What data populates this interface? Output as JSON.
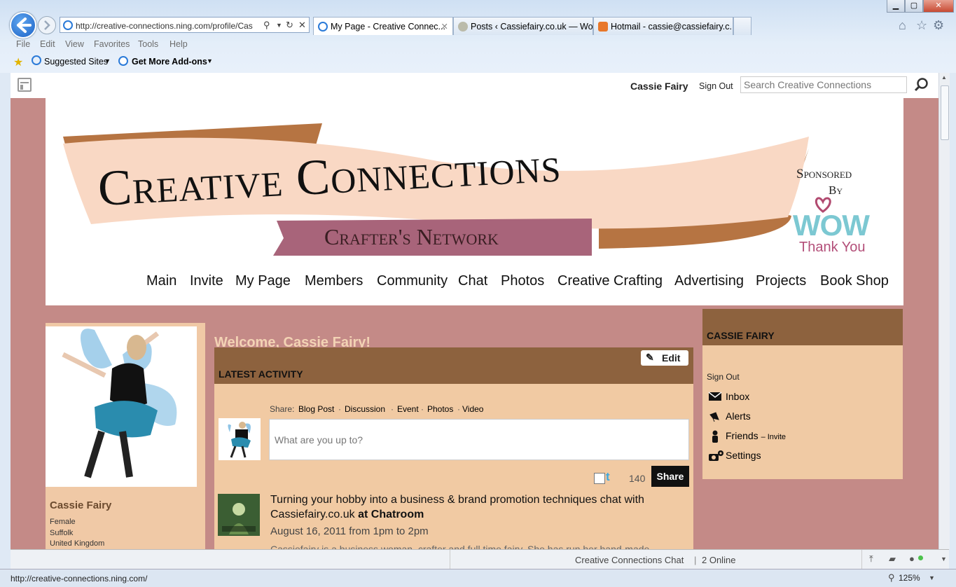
{
  "browser": {
    "url": "http://creative-connections.ning.com/profile/Cas",
    "tabs": [
      {
        "title": "My Page - Creative Connec..."
      },
      {
        "title": "Posts ‹ Cassiefairy.co.uk — Wo..."
      },
      {
        "title": "Hotmail - cassie@cassiefairy.c..."
      }
    ],
    "menu": [
      "File",
      "Edit",
      "View",
      "Favorites",
      "Tools",
      "Help"
    ],
    "favorites": {
      "suggested": "Suggested Sites",
      "addons": "Get More Add-ons"
    },
    "status_url": "http://creative-connections.ning.com/",
    "zoom": "125%"
  },
  "site": {
    "user_name": "Cassie Fairy",
    "sign_out": "Sign Out",
    "search_placeholder": "Search Creative Connections",
    "banner": {
      "title": "Creative Connections",
      "subtitle": "Crafter's Network",
      "sponsored": "Sponsored",
      "by": "By",
      "sponsor_logo": "WOW",
      "sponsor_tag": "Thank You"
    },
    "nav": [
      "Main",
      "Invite",
      "My Page",
      "Members",
      "Community",
      "Chat",
      "Photos",
      "Creative Crafting",
      "Advertising",
      "Projects",
      "Book Shop"
    ]
  },
  "profile": {
    "name": "Cassie Fairy",
    "details": [
      "Female",
      "Suffolk",
      "United Kingdom"
    ]
  },
  "main": {
    "welcome": "Welcome, Cassie Fairy!",
    "edit_label": "Edit",
    "latest_activity": "LATEST ACTIVITY",
    "share_label": "Share:",
    "share_options": [
      "Blog Post",
      "Discussion",
      "Event",
      "Photos",
      "Video"
    ],
    "status_placeholder": "What are you up to?",
    "char_count": "140",
    "share_button": "Share",
    "activity": {
      "title": "Turning your hobby into a business & brand promotion techniques chat with Cassiefairy.co.uk",
      "location": "at Chatroom",
      "date": "August 16, 2011 from 1pm to 2pm",
      "excerpt": "Cassiefairy is a business woman, crafter and full time fairy. She has run her hand-made"
    }
  },
  "sidebar": {
    "heading": "CASSIE FAIRY",
    "sign_out": "Sign Out",
    "items": [
      {
        "label": "Inbox",
        "icon": "envelope-icon"
      },
      {
        "label": "Alerts",
        "icon": "megaphone-icon"
      },
      {
        "label": "Friends",
        "extra": "– Invite",
        "icon": "person-icon"
      },
      {
        "label": "Settings",
        "icon": "camera-gear-icon"
      }
    ]
  },
  "chatbar": {
    "title": "Creative Connections Chat",
    "sep": "|",
    "online": "2 Online"
  },
  "colors": {
    "page_bg": "#c48a87",
    "panel_bg": "#f0caa4",
    "header_bg": "#8d623e",
    "ribbon": "#f9d8c4",
    "ribbon_dark": "#b67442",
    "subtitle_band": "#a8647a"
  }
}
